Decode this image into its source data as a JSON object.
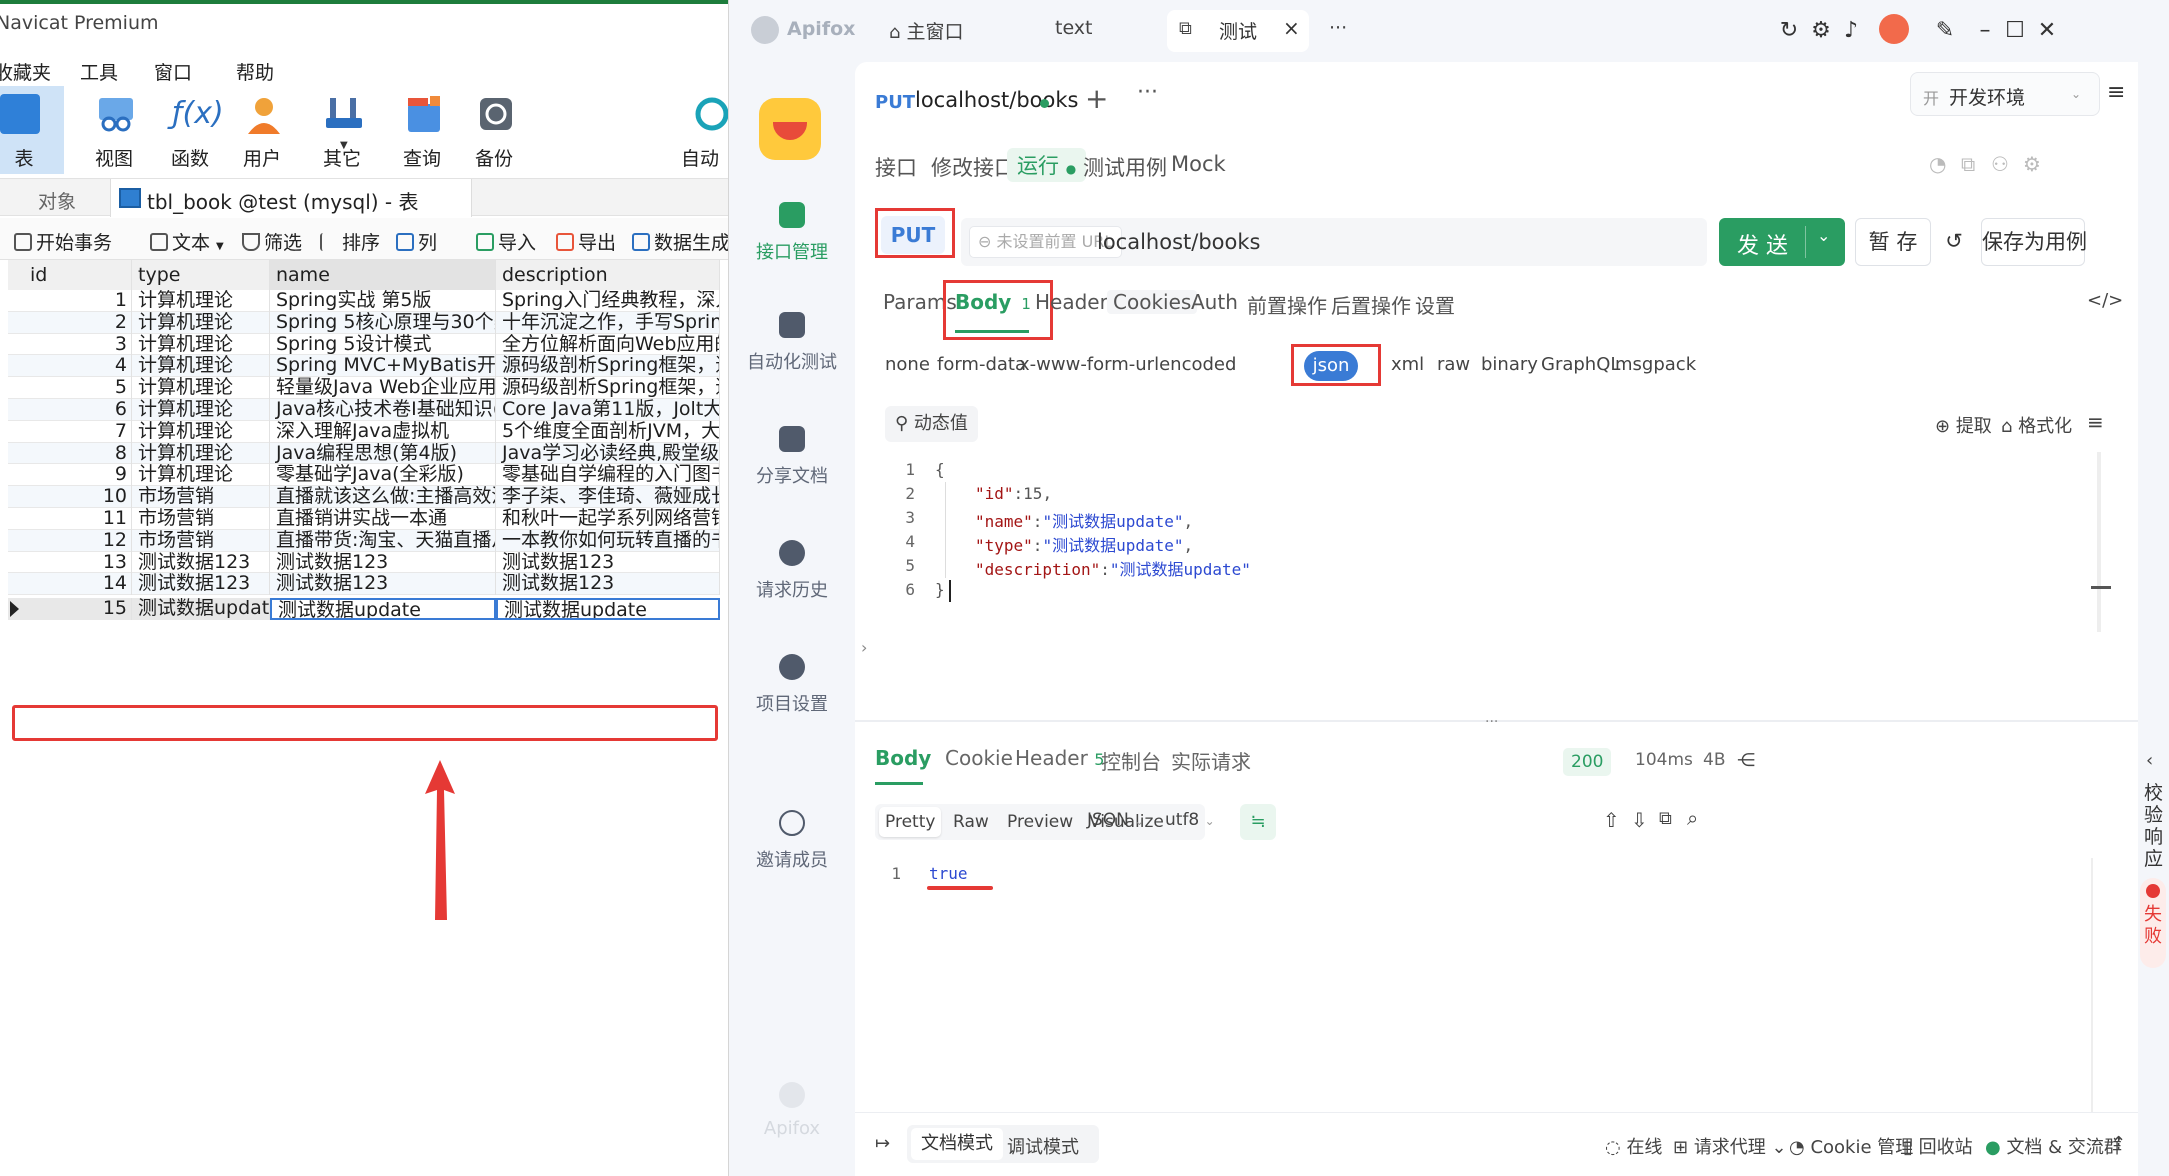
{
  "navicat": {
    "title": "Navicat Premium",
    "menu": [
      "收藏夹",
      "工具",
      "窗口",
      "帮助"
    ],
    "toolbar": [
      {
        "label": "表",
        "icon": "table-icon"
      },
      {
        "label": "视图",
        "icon": "view-icon"
      },
      {
        "label": "函数",
        "icon": "function-icon"
      },
      {
        "label": "用户",
        "icon": "user-icon"
      },
      {
        "label": "其它",
        "icon": "tools-icon"
      },
      {
        "label": "查询",
        "icon": "query-icon"
      },
      {
        "label": "备份",
        "icon": "backup-icon"
      },
      {
        "label": "自动",
        "icon": "automation-icon"
      }
    ],
    "tabs": {
      "objects": "对象",
      "table_tab": "tbl_book @test (mysql) - 表"
    },
    "actions": [
      "开始事务",
      "文本",
      "筛选",
      "排序",
      "列",
      "导入",
      "导出",
      "数据生成"
    ],
    "grid": {
      "columns": [
        "id",
        "type",
        "name",
        "description"
      ],
      "rows": [
        [
          "1",
          "计算机理论",
          "Spring实战 第5版",
          "Spring入门经典教程，深入"
        ],
        [
          "2",
          "计算机理论",
          "Spring 5核心原理与30个类",
          "十年沉淀之作，手写Spring"
        ],
        [
          "3",
          "计算机理论",
          "Spring 5设计模式",
          "全方位解析面向Web应用的"
        ],
        [
          "4",
          "计算机理论",
          "Spring MVC+MyBatis开发",
          "源码级剖析Spring框架，适"
        ],
        [
          "5",
          "计算机理论",
          "轻量级Java Web企业应用",
          "源码级剖析Spring框架，适"
        ],
        [
          "6",
          "计算机理论",
          "Java核心技术卷I基础知识(",
          "Core Java第11版，Jolt大奖"
        ],
        [
          "7",
          "计算机理论",
          "深入理解Java虚拟机",
          "5个维度全面剖析JVM，大"
        ],
        [
          "8",
          "计算机理论",
          "Java编程思想(第4版)",
          "Java学习必读经典,殿堂级著"
        ],
        [
          "9",
          "计算机理论",
          "零基础学Java(全彩版)",
          "零基础自学编程的入门图书"
        ],
        [
          "10",
          "市场营销",
          "直播就该这么做:主播高效沟",
          "李子柒、李佳琦、薇娅成长"
        ],
        [
          "11",
          "市场营销",
          "直播销讲实战一本通",
          "和秋叶一起学系列网络营销"
        ],
        [
          "12",
          "市场营销",
          "直播带货:淘宝、天猫直播从",
          "一本教你如何玩转直播的书"
        ],
        [
          "13",
          "测试数据123",
          "测试数据123",
          "测试数据123"
        ],
        [
          "14",
          "测试数据123",
          "测试数据123",
          "测试数据123"
        ],
        [
          "15",
          "测试数据update",
          "测试数据update",
          "测试数据update"
        ]
      ]
    }
  },
  "apifox": {
    "app_name": "Apifox",
    "window_tabs": {
      "home": "主窗口",
      "text": "text",
      "test": "测试",
      "more": "···"
    },
    "sidebar": [
      {
        "label": "接口管理",
        "icon": "api-management-icon"
      },
      {
        "label": "自动化测试",
        "icon": "automation-test-icon"
      },
      {
        "label": "分享文档",
        "icon": "share-docs-icon"
      },
      {
        "label": "请求历史",
        "icon": "history-icon"
      },
      {
        "label": "项目设置",
        "icon": "settings-icon"
      },
      {
        "label": "邀请成员",
        "icon": "invite-member-icon"
      }
    ],
    "sidebar_footer": "Apifox",
    "api_tab": {
      "method": "PUT",
      "url": "localhost/books"
    },
    "environment": {
      "badge": "开",
      "name": "开发环境"
    },
    "sub_tabs": [
      "接口",
      "修改接口",
      "运行",
      "测试用例",
      "Mock"
    ],
    "request": {
      "method": "PUT",
      "prefix": "未设置前置 URL",
      "url": "localhost/books",
      "send": "发 送",
      "save": "暂 存",
      "save_case": "保存为用例"
    },
    "param_tabs": {
      "params": "Params",
      "body": "Body",
      "body_count": "1",
      "headers": "Headers",
      "cookies": "Cookies",
      "auth": "Auth",
      "pre": "前置操作",
      "post": "后置操作",
      "settings": "设置"
    },
    "body_types": [
      "none",
      "form-data",
      "x-www-form-urlencoded",
      "json",
      "xml",
      "raw",
      "binary",
      "GraphQL",
      "msgpack"
    ],
    "editor": {
      "dynamic": "动态值",
      "extract": "提取",
      "format": "格式化",
      "lines": [
        "1",
        "2",
        "3",
        "4",
        "5",
        "6"
      ],
      "code": {
        "open": "{",
        "id_key": "\"id\"",
        "id_val": "15,",
        "name_key": "\"name\"",
        "name_val": "\"测试数据update\"",
        "type_key": "\"type\"",
        "type_val": "\"测试数据update\"",
        "desc_key": "\"description\"",
        "desc_val": "\"测试数据update\"",
        "close": "}"
      }
    },
    "response": {
      "tabs": {
        "body": "Body",
        "cookie": "Cookie",
        "header": "Header",
        "header_count": "5",
        "console": "控制台",
        "actual": "实际请求"
      },
      "status": "200",
      "time": "104ms",
      "size": "4B",
      "views": [
        "Pretty",
        "Raw",
        "Preview",
        "Visualize"
      ],
      "format": "JSON",
      "encoding": "utf8",
      "line": "1",
      "value": "true"
    },
    "validate": {
      "label": "校验响应",
      "result": "失败"
    },
    "footer": {
      "doc_mode": "文档模式",
      "debug_mode": "调试模式",
      "online": "在线",
      "proxy": "请求代理",
      "cookie": "Cookie 管理",
      "recycle": "回收站",
      "community": "文档 & 交流群"
    }
  }
}
